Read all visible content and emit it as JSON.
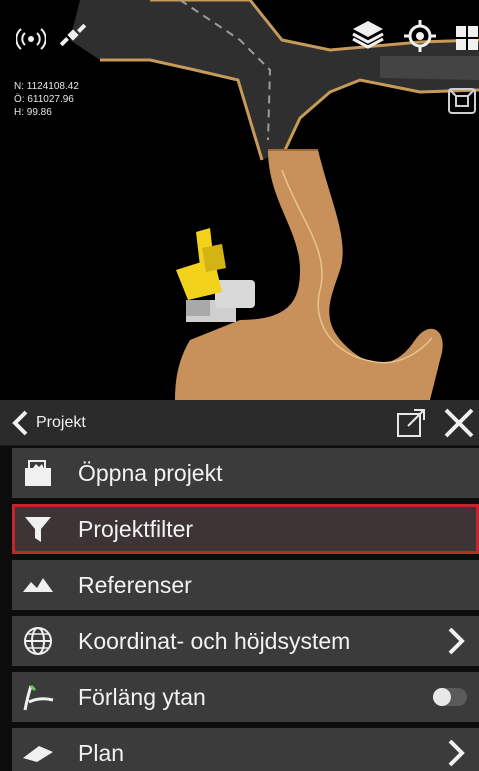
{
  "status": {
    "gps_icon": "gps-signal-icon",
    "satellite_icon": "satellite-icon",
    "satellite_caption": "",
    "layers_icon": "layers-icon",
    "layers_caption": "",
    "locate_icon": "locate-icon",
    "cube_icon": "cube-view-icon",
    "view_icon": "view-mode-icon"
  },
  "coords": {
    "north": "N: 1124108.42",
    "east": "Ö: 611027.96",
    "height": "H: 99.86"
  },
  "panel": {
    "back_label": "Projekt",
    "popout_icon": "popout-icon",
    "close_icon": "close-icon"
  },
  "menu": {
    "items": [
      {
        "label": "Öppna projekt",
        "icon": "folder-icon"
      },
      {
        "label": "Projektfilter",
        "icon": "filter-icon",
        "selected": true
      },
      {
        "label": "Referenser",
        "icon": "references-icon"
      },
      {
        "label": "Koordinat- och höjdsystem",
        "icon": "globe-icon",
        "caption": "",
        "chevron": true
      },
      {
        "label": "Förläng ytan",
        "icon": "extend-surface-icon",
        "toggle": false
      },
      {
        "label": "Plan",
        "icon": "plan-icon",
        "chevron": true
      }
    ]
  },
  "colors": {
    "road_asphalt": "#333333",
    "road_edge": "#c79a5a",
    "ground_sand": "#c8905a",
    "machine_yellow": "#f2d21b",
    "selection_red": "#c0262c",
    "panel_bg": "#3b3b3b",
    "header_bg": "#2b2b2b"
  }
}
